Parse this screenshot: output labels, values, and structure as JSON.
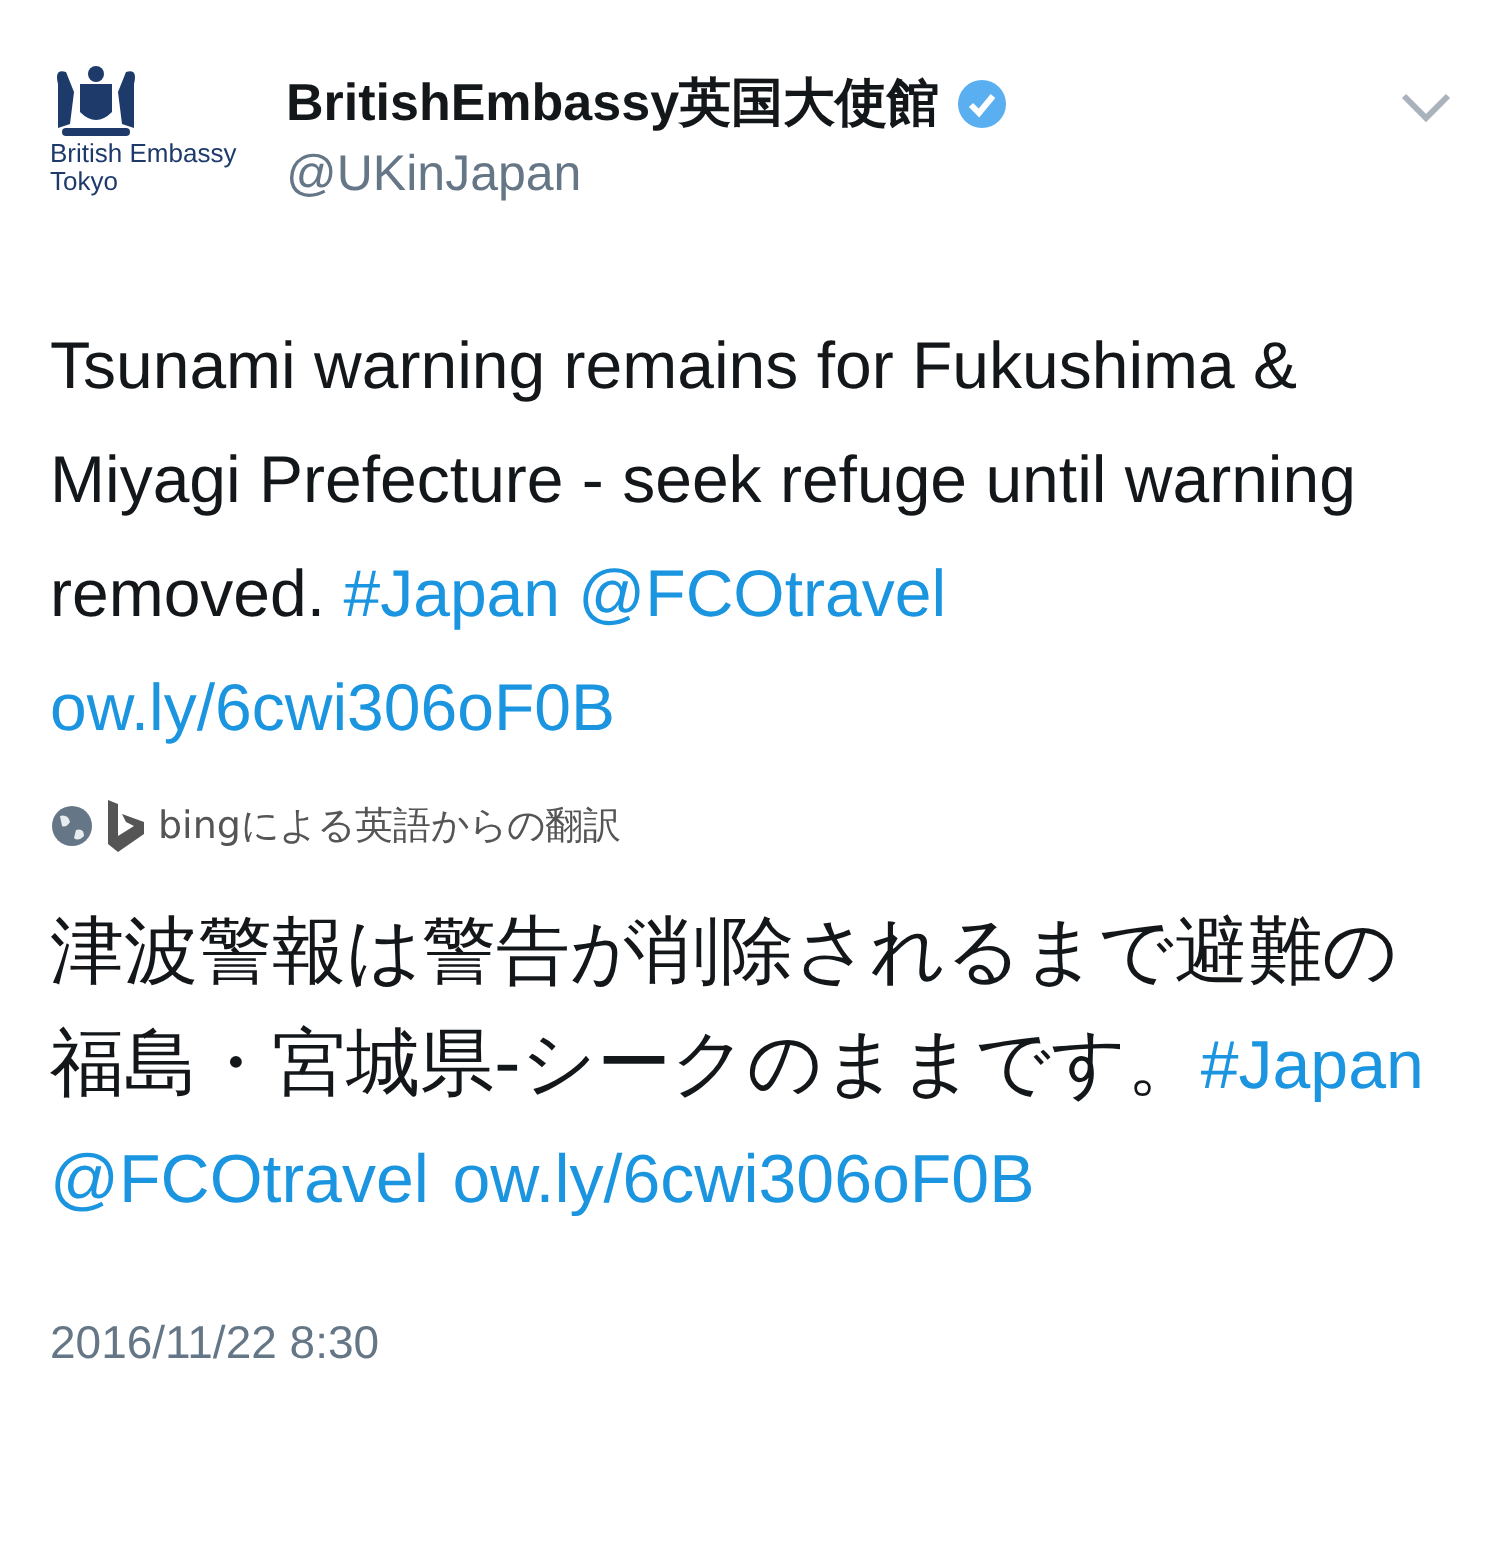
{
  "account": {
    "logo_text": "British Embassy Tokyo",
    "name": "BritishEmbassy英国大使館",
    "verified": true,
    "handle": "@UKinJapan"
  },
  "tweet": [
    {
      "kind": "text",
      "text": "Tsunami warning remains for Fukushima & Miyagi Prefecture - seek refuge until warning removed. "
    },
    {
      "kind": "link",
      "text": "#Japan"
    },
    {
      "kind": "link",
      "text": "@FCOtravel"
    },
    {
      "kind": "link",
      "text": "ow.ly/6cwi306oF0B"
    }
  ],
  "translation_note": "bingによる英語からの翻訳",
  "translation": [
    {
      "kind": "text",
      "text": "津波警報は警告が削除されるまで避難の福島・宮城県-シークのままです。"
    },
    {
      "kind": "link",
      "text": "#Japan"
    },
    {
      "kind": "link",
      "text": "@FCOtravel"
    },
    {
      "kind": "link",
      "text": "ow.ly/"
    },
    {
      "kind": "link_continued",
      "text": "6cwi306oF0B"
    }
  ],
  "timestamp": "2016/11/22 8:30"
}
